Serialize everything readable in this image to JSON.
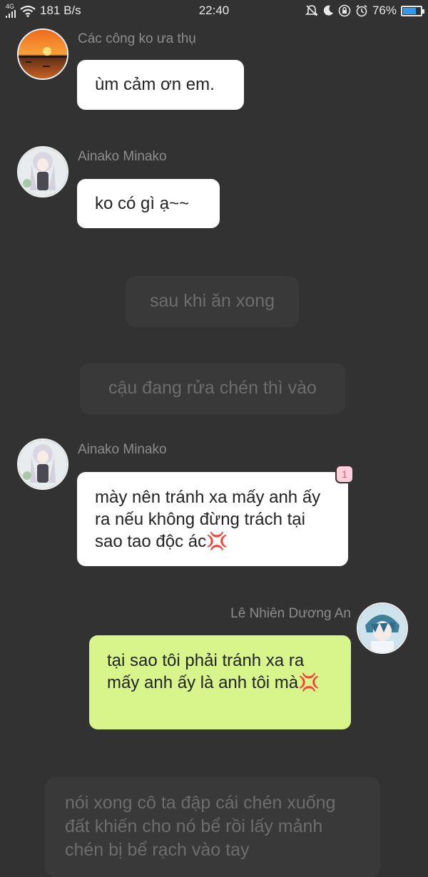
{
  "status_bar": {
    "network": "4G",
    "speed": "181 B/s",
    "time": "22:40",
    "battery": "76%",
    "battery_level": 0.76
  },
  "messages": [
    {
      "sender": "Các công ko ưa thụ",
      "text": "ùm cảm ơn em."
    },
    {
      "sender": "Ainako Minako",
      "text": "ko có gì ạ~~"
    },
    {
      "text": "sau khi ăn xong"
    },
    {
      "text": "cậu đang rửa chén thì  vào"
    },
    {
      "sender": "Ainako Minako",
      "text": "mày nên tránh xa mấy anh ấy ra nếu không đừng trách tại sao tao độc ác💢",
      "badge": "1"
    },
    {
      "sender": "Lê Nhiên Dương An",
      "text": "tại sao tôi phải tránh xa ra mấy anh ấy là anh tôi mà💢"
    },
    {
      "text": "nói xong cô ta đập cái chén xuống đất khiến cho nó bể rồi lấy mảnh chén bị bể rạch vào tay"
    }
  ]
}
